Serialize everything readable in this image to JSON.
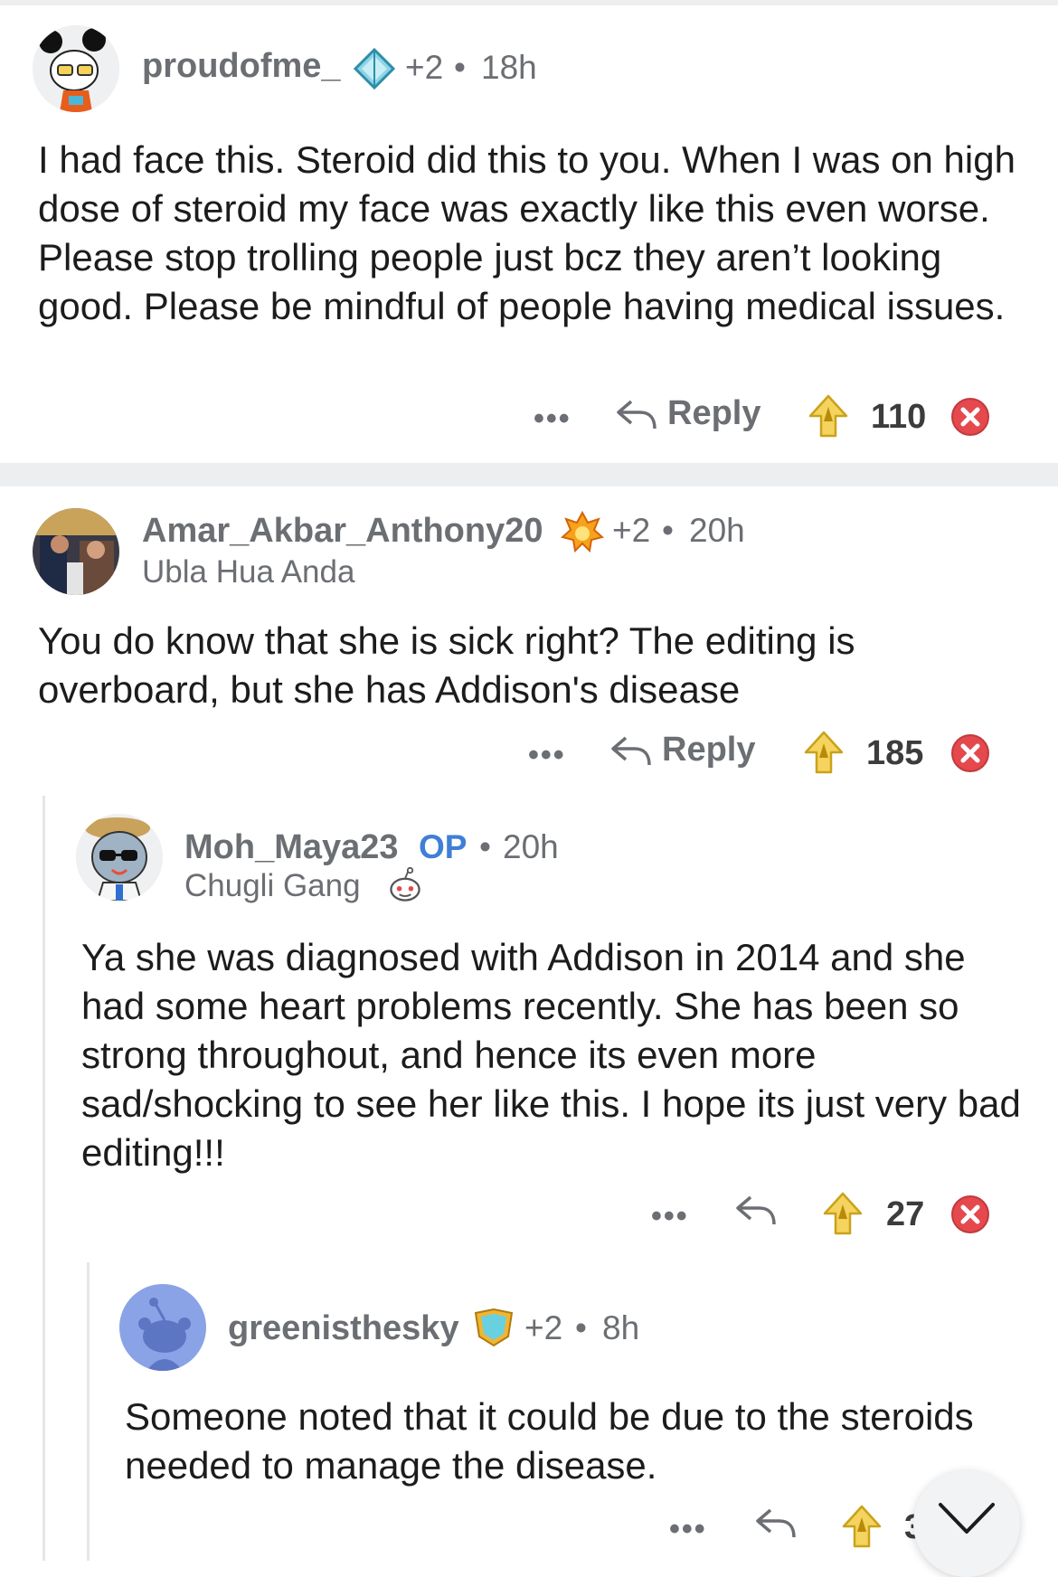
{
  "comments": [
    {
      "username": "proudofme_",
      "award_count": "+2",
      "time": "18h",
      "body": "I had face this. Steroid did this to you. When I was on high dose of steroid my face was exactly like this even worse. Please stop trolling people just bcz they aren’t looking good. Please be mindful of people having medical issues.",
      "more": "•••",
      "reply_label": "Reply",
      "score": "110"
    },
    {
      "username": "Amar_Akbar_Anthony20",
      "award_count": "+2",
      "time": "20h",
      "flair": "Ubla Hua Anda",
      "body": "You do know that she is sick right? The editing is overboard, but she has Addison's disease",
      "more": "•••",
      "reply_label": "Reply",
      "score": "185"
    },
    {
      "username": "Moh_Maya23",
      "op_tag": "OP",
      "time": "20h",
      "flair": "Chugli Gang",
      "body": "Ya she was diagnosed with Addison in 2014 and she had some heart problems recently. She has been so strong throughout, and hence its even more sad/shocking to see her like this. I hope its just very bad editing!!!",
      "more": "•••",
      "score": "27"
    },
    {
      "username": "greenisthesky",
      "award_count": "+2",
      "time": "8h",
      "body": "Someone noted that it could be due to the steroids needed to manage the disease.",
      "more": "•••",
      "score": "3"
    }
  ],
  "icons": {
    "reply": "reply-arrow-icon",
    "upvote": "golden-upvote-icon",
    "downvote": "downvote-icon",
    "scroll": "chevron-down-icon",
    "more": "more-dots-icon"
  },
  "colors": {
    "muted": "#6b6e72",
    "op": "#3f7fd6",
    "upvote_gold": "#e7b824",
    "downvote_red": "#e5484d",
    "separator": "#eceef0"
  }
}
